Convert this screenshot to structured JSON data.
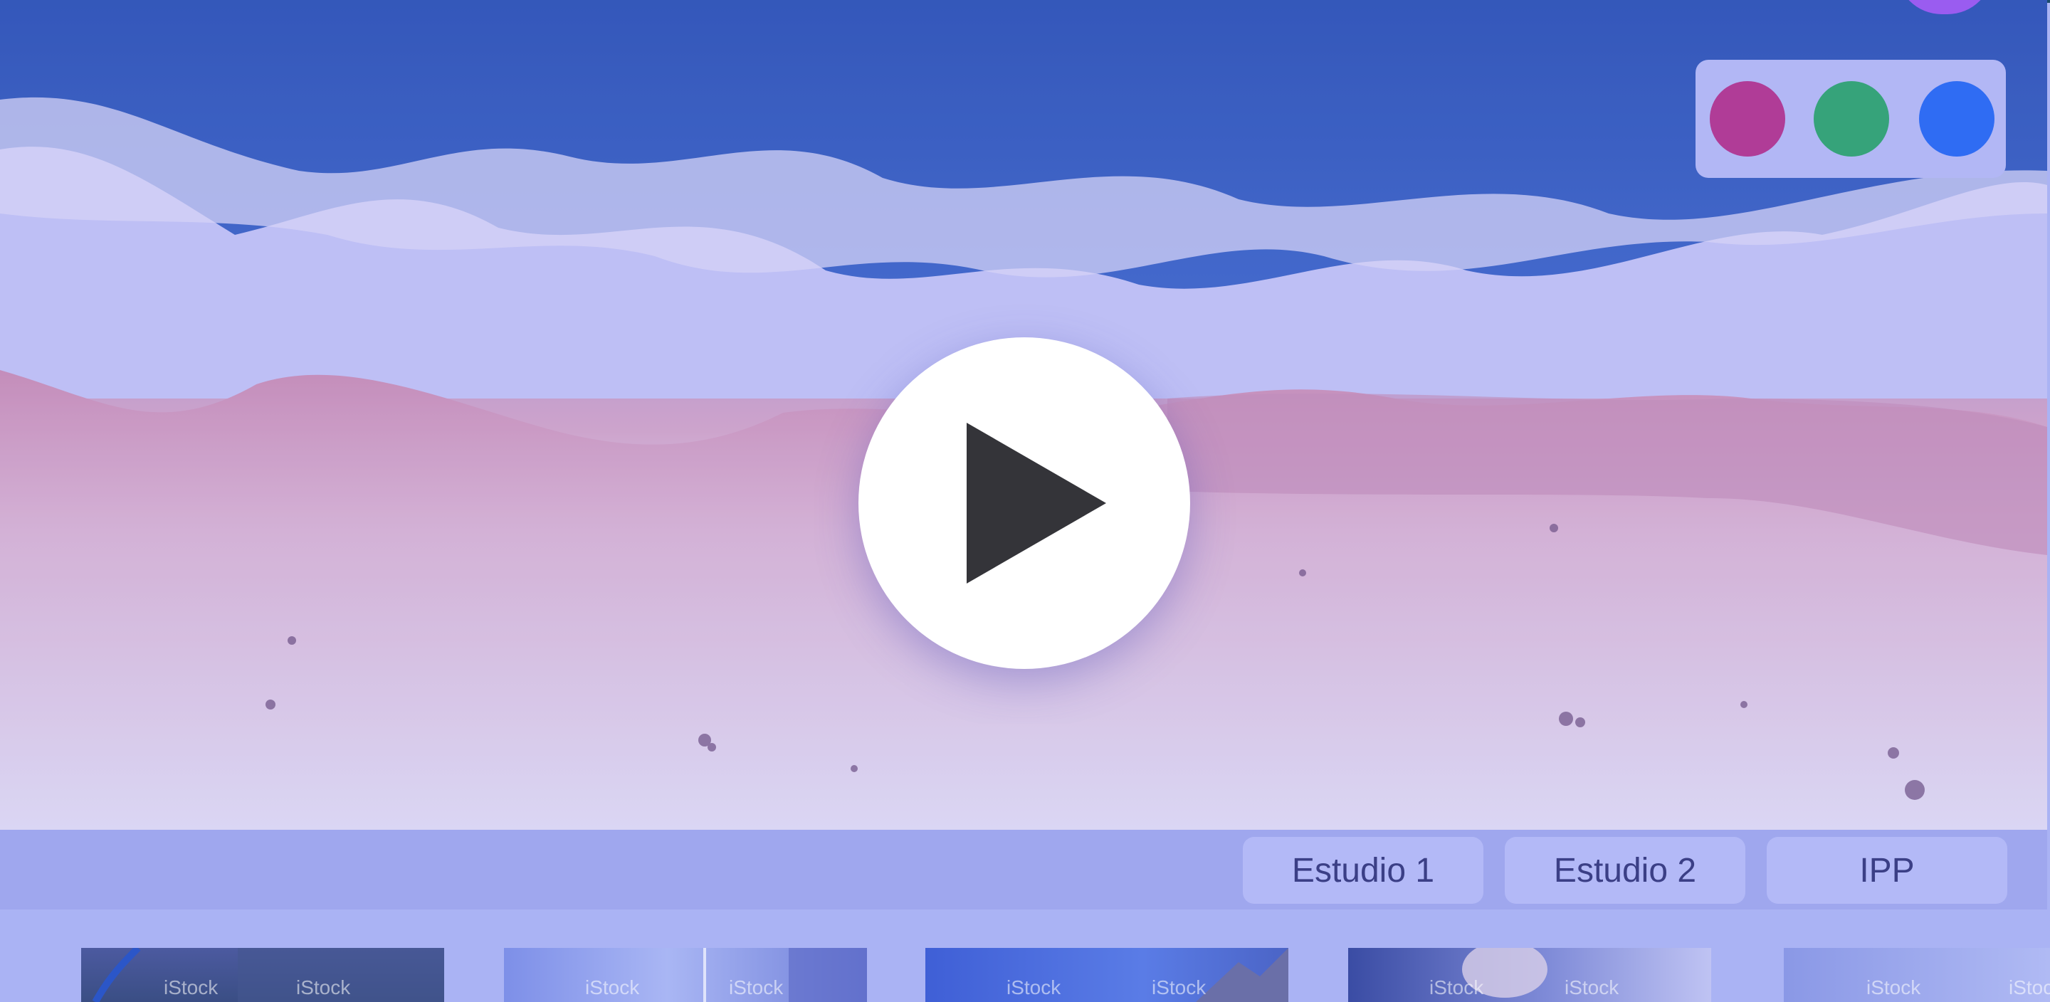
{
  "video": {
    "play_label": "Play",
    "colors": {
      "swatch_magenta": "#b03c97",
      "swatch_green": "#36a37a",
      "swatch_blue": "#2f6cf3"
    }
  },
  "tabs": [
    {
      "label": "Estudio 1"
    },
    {
      "label": "Estudio 2"
    },
    {
      "label": "IPP"
    }
  ],
  "thumbnails": [
    {
      "watermark": "iStock"
    },
    {
      "watermark": "iStock"
    },
    {
      "watermark": "iStock"
    },
    {
      "watermark": "iStock"
    },
    {
      "watermark": "iStock"
    }
  ]
}
